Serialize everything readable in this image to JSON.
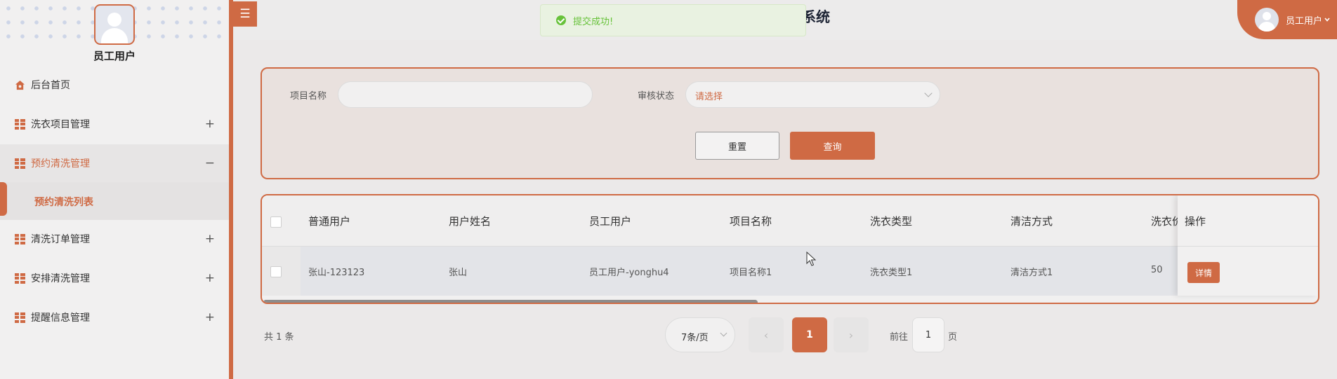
{
  "sidebar": {
    "username": "员工用户",
    "items": [
      {
        "label": "后台首页"
      },
      {
        "label": "洗衣项目管理",
        "sign": "+"
      },
      {
        "label": "预约清洗管理",
        "sign": "−"
      },
      {
        "label": "清洗订单管理",
        "sign": "+"
      },
      {
        "label": "安排清洗管理",
        "sign": "+"
      },
      {
        "label": "提醒信息管理",
        "sign": "+"
      }
    ],
    "sub_item": "预约清洗列表"
  },
  "header": {
    "menu_toggle": "☰",
    "title_fragment": "系统",
    "toast": "提交成功!",
    "user": "员工用户"
  },
  "search": {
    "project_label": "项目名称",
    "project_value": "",
    "status_label": "审核状态",
    "status_placeholder": "请选择",
    "reset": "重置",
    "query": "查询"
  },
  "table": {
    "columns": [
      "普通用户",
      "用户姓名",
      "员工用户",
      "项目名称",
      "洗衣类型",
      "清洁方式",
      "洗衣价"
    ],
    "actions_header": "操作",
    "rows": [
      {
        "cells": [
          "张山-123123",
          "张山",
          "员工用户-yonghu4",
          "项目名称1",
          "洗衣类型1",
          "清洁方式1",
          "50"
        ],
        "action": "详情"
      }
    ]
  },
  "pagination": {
    "total": "共 1 条",
    "page_size": "7条/页",
    "prev": "‹",
    "next": "›",
    "current": "1",
    "goto_label": "前往",
    "goto_value": "1",
    "goto_unit": "页"
  },
  "colors": {
    "accent": "#cf6a44",
    "success": "#67c23a"
  }
}
